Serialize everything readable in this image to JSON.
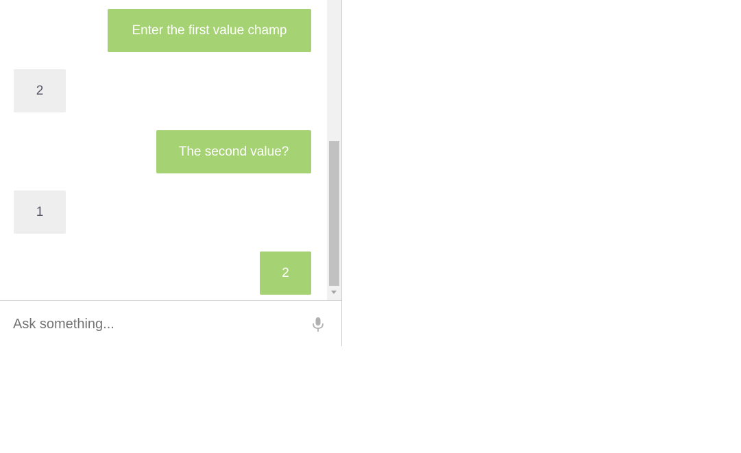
{
  "chat": {
    "messages": [
      {
        "sender": "agent",
        "text": "Enter the first value champ"
      },
      {
        "sender": "user",
        "text": "2"
      },
      {
        "sender": "agent",
        "text": "The second value?"
      },
      {
        "sender": "user",
        "text": "1"
      },
      {
        "sender": "agent",
        "text": "2"
      }
    ]
  },
  "input": {
    "placeholder": "Ask something...",
    "value": ""
  },
  "icons": {
    "microphone": "microphone-icon"
  },
  "colors": {
    "agent_bubble": "#a5d273",
    "user_bubble": "#eeeeee",
    "mic_icon": "#b0b0b0"
  }
}
